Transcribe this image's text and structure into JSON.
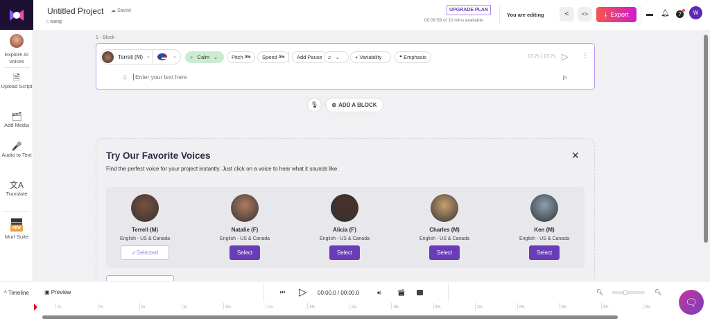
{
  "header": {
    "project_title": "Untitled Project",
    "saved": "Saved",
    "breadcrumb": "wang",
    "upgrade": "UPGRADE PLAN",
    "usage": "00:09:59 of 10 mins available",
    "editing": "You are editing",
    "export": "Export",
    "avatar_initial": "W"
  },
  "sidebar": {
    "items": [
      {
        "label": "Explore AI Voices"
      },
      {
        "label": "Upload Script",
        "icon": "upload-script-icon"
      },
      {
        "label": "Add Media",
        "icon": "media-icon"
      },
      {
        "label": "Audio to Text",
        "icon": "audio-to-text-icon"
      },
      {
        "label": "Translate",
        "icon": "translate-icon"
      },
      {
        "label": "Murf Suite",
        "icon": "grid-icon",
        "badge": "NEW"
      }
    ]
  },
  "block": {
    "label": "1 -  Block",
    "voice": "Terrell (M)",
    "style": "Calm",
    "pitch_label": "Pitch",
    "pitch": "0%",
    "speed_label": "Speed",
    "speed": "0%",
    "add_pause": "Add Pause",
    "variability": "Variability",
    "emphasis": "Emphasis",
    "duration": "13.7s | 13.7s",
    "placeholder": "Enter your text here"
  },
  "add_block": "ADD A BLOCK",
  "panel": {
    "title": "Try Our Favorite Voices",
    "description": "Find the perfect voice for your project instantly. Just click on a voice to hear what it sounds like.",
    "voices": [
      {
        "name": "Terrell (M)",
        "lang": "English - US & Canada",
        "button": "Selected",
        "selected": true
      },
      {
        "name": "Natalie (F)",
        "lang": "English - US & Canada",
        "button": "Select"
      },
      {
        "name": "Alicia (F)",
        "lang": "English - US & Canada",
        "button": "Select"
      },
      {
        "name": "Charles (M)",
        "lang": "English - US & Canada",
        "button": "Select"
      },
      {
        "name": "Ken (M)",
        "lang": "English - US & Canada",
        "button": "Select"
      }
    ]
  },
  "player": {
    "timeline": "Timeline",
    "preview": "Preview",
    "time": "00:00.0 / 00:00.0",
    "ticks": [
      "2s",
      "4s",
      "6s",
      "8s",
      "10s",
      "12s",
      "14s",
      "16s",
      "18s",
      "20s",
      "22s",
      "24s",
      "26s",
      "28s",
      "30s"
    ],
    "zoom_level": 0.4
  },
  "colors": {
    "accent": "#6a3db8",
    "export_start": "#f4574a",
    "export_end": "#d11ad0",
    "block_border": "#b79af0"
  }
}
